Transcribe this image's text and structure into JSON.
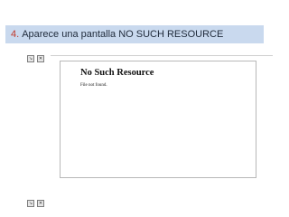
{
  "step": {
    "number": "4.",
    "text": "Aparece una pantalla NO SUCH RESOURCE"
  },
  "toolbar_icons": [
    "resize-icon",
    "close-icon"
  ],
  "page": {
    "title": "No Such Resource",
    "body": "File not found."
  }
}
